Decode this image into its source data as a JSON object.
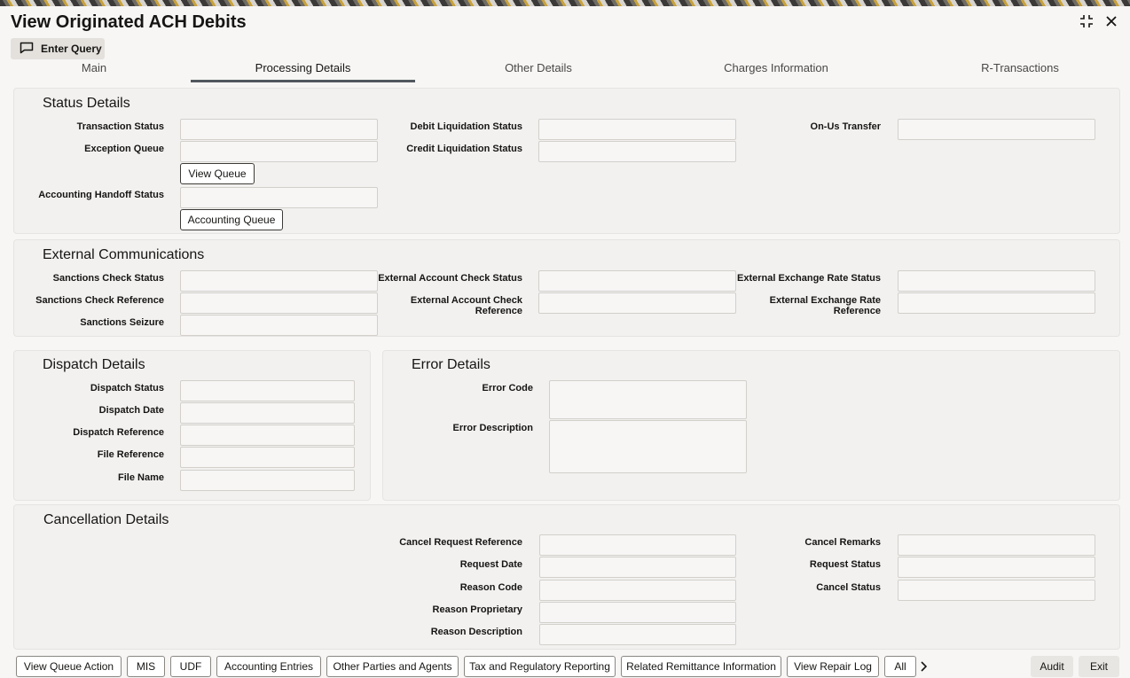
{
  "window": {
    "title": "View Originated ACH Debits",
    "maximize_icon": "collapse-icon",
    "close_icon": "close-icon"
  },
  "toolbar": {
    "enter_query_label": "Enter Query"
  },
  "tabs": [
    {
      "label": "Main"
    },
    {
      "label": "Processing Details",
      "active": true
    },
    {
      "label": "Other Details"
    },
    {
      "label": "Charges Information"
    },
    {
      "label": "R-Transactions"
    }
  ],
  "status_details": {
    "title": "Status Details",
    "transaction_status_label": "Transaction Status",
    "exception_queue_label": "Exception Queue",
    "view_queue_label": "View Queue",
    "accounting_handoff_status_label": "Accounting Handoff Status",
    "accounting_queue_label": "Accounting Queue",
    "debit_liquidation_status_label": "Debit Liquidation Status",
    "credit_liquidation_status_label": "Credit Liquidation Status",
    "on_us_transfer_label": "On-Us Transfer"
  },
  "external_communications": {
    "title": "External Communications",
    "sanctions_check_status_label": "Sanctions Check Status",
    "sanctions_check_reference_label": "Sanctions Check Reference",
    "sanctions_seizure_label": "Sanctions Seizure",
    "external_account_check_status_label": "External Account Check Status",
    "external_account_check_reference_label_1": "External Account Check",
    "external_account_check_reference_label_2": "Reference",
    "external_exchange_rate_status_label": "External Exchange Rate Status",
    "external_exchange_rate_reference_label_1": "External Exchange Rate",
    "external_exchange_rate_reference_label_2": "Reference"
  },
  "dispatch_details": {
    "title": "Dispatch Details",
    "dispatch_status_label": "Dispatch Status",
    "dispatch_date_label": "Dispatch Date",
    "dispatch_reference_label": "Dispatch Reference",
    "file_reference_label": "File Reference",
    "file_name_label": "File Name"
  },
  "error_details": {
    "title": "Error Details",
    "error_code_label": "Error Code",
    "error_description_label": "Error Description"
  },
  "cancellation_details": {
    "title": "Cancellation Details",
    "cancel_request_reference_label": "Cancel Request Reference",
    "request_date_label": "Request Date",
    "reason_code_label": "Reason Code",
    "reason_proprietary_label": "Reason Proprietary",
    "reason_description_label": "Reason Description",
    "cancel_remarks_label": "Cancel Remarks",
    "request_status_label": "Request Status",
    "cancel_status_label": "Cancel Status"
  },
  "footer": {
    "buttons": [
      "View Queue Action",
      "MIS",
      "UDF",
      "Accounting Entries",
      "Other Parties and Agents",
      "Tax and Regulatory Reporting",
      "Related Remittance Information",
      "View Repair Log",
      "All"
    ],
    "next_icon": "chevron-right-icon",
    "audit_label": "Audit",
    "exit_label": "Exit"
  }
}
